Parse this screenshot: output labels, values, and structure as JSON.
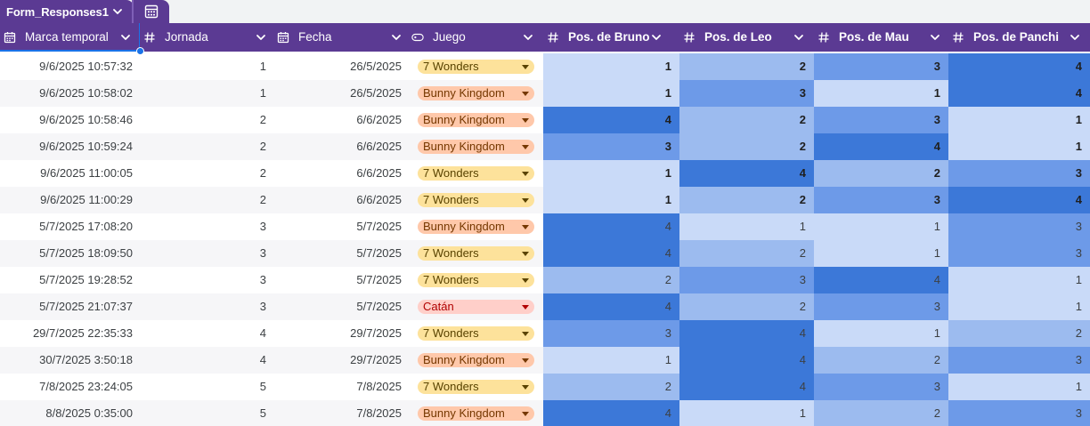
{
  "tabs": {
    "active_label": "Form_Responses1"
  },
  "colors": {
    "header_bg": "#5b3a93",
    "selection": "#1a73e8",
    "row_alt": "#f6f6f8",
    "pos_scale": {
      "1": "#c9daf8",
      "2": "#9cbbef",
      "3": "#6d9ae8",
      "4": "#3c78d8"
    },
    "chips": {
      "7 Wonders": {
        "bg": "#fde29b",
        "fg": "#594300"
      },
      "Bunny Kingdom": {
        "bg": "#ffc8aa",
        "fg": "#753800"
      },
      "Catán": {
        "bg": "#ffcfc9",
        "fg": "#b10202"
      }
    }
  },
  "columns": [
    {
      "label": "Marca temporal",
      "type_icon": "calendar-icon",
      "bold": false
    },
    {
      "label": "Jornada",
      "type_icon": "hash-icon",
      "bold": false
    },
    {
      "label": "Fecha",
      "type_icon": "calendar-icon",
      "bold": false
    },
    {
      "label": "Juego",
      "type_icon": "dropdown-chip-icon",
      "bold": false
    },
    {
      "label": "Pos. de Bruno",
      "type_icon": "hash-icon",
      "bold": true
    },
    {
      "label": "Pos. de Leo",
      "type_icon": "hash-icon",
      "bold": true
    },
    {
      "label": "Pos. de Mau",
      "type_icon": "hash-icon",
      "bold": true
    },
    {
      "label": "Pos. de Panchi",
      "type_icon": "hash-icon",
      "bold": true
    }
  ],
  "rows": [
    {
      "marca": "9/6/2025 10:57:32",
      "jornada": "1",
      "fecha": "26/5/2025",
      "juego": "7 Wonders",
      "pos": [
        "1",
        "2",
        "3",
        "4"
      ],
      "bold": true
    },
    {
      "marca": "9/6/2025 10:58:02",
      "jornada": "1",
      "fecha": "26/5/2025",
      "juego": "Bunny Kingdom",
      "pos": [
        "1",
        "3",
        "1",
        "4"
      ],
      "bold": true
    },
    {
      "marca": "9/6/2025 10:58:46",
      "jornada": "2",
      "fecha": "6/6/2025",
      "juego": "Bunny Kingdom",
      "pos": [
        "4",
        "2",
        "3",
        "1"
      ],
      "bold": true
    },
    {
      "marca": "9/6/2025 10:59:24",
      "jornada": "2",
      "fecha": "6/6/2025",
      "juego": "Bunny Kingdom",
      "pos": [
        "3",
        "2",
        "4",
        "1"
      ],
      "bold": true
    },
    {
      "marca": "9/6/2025 11:00:05",
      "jornada": "2",
      "fecha": "6/6/2025",
      "juego": "7 Wonders",
      "pos": [
        "1",
        "4",
        "2",
        "3"
      ],
      "bold": true
    },
    {
      "marca": "9/6/2025 11:00:29",
      "jornada": "2",
      "fecha": "6/6/2025",
      "juego": "7 Wonders",
      "pos": [
        "1",
        "2",
        "3",
        "4"
      ],
      "bold": true
    },
    {
      "marca": "5/7/2025 17:08:20",
      "jornada": "3",
      "fecha": "5/7/2025",
      "juego": "Bunny Kingdom",
      "pos": [
        "4",
        "1",
        "1",
        "3"
      ],
      "bold": false
    },
    {
      "marca": "5/7/2025 18:09:50",
      "jornada": "3",
      "fecha": "5/7/2025",
      "juego": "7 Wonders",
      "pos": [
        "4",
        "2",
        "1",
        "3"
      ],
      "bold": false
    },
    {
      "marca": "5/7/2025 19:28:52",
      "jornada": "3",
      "fecha": "5/7/2025",
      "juego": "7 Wonders",
      "pos": [
        "2",
        "3",
        "4",
        "1"
      ],
      "bold": false
    },
    {
      "marca": "5/7/2025 21:07:37",
      "jornada": "3",
      "fecha": "5/7/2025",
      "juego": "Catán",
      "pos": [
        "4",
        "2",
        "3",
        "1"
      ],
      "bold": false
    },
    {
      "marca": "29/7/2025 22:35:33",
      "jornada": "4",
      "fecha": "29/7/2025",
      "juego": "7 Wonders",
      "pos": [
        "3",
        "4",
        "1",
        "2"
      ],
      "bold": false
    },
    {
      "marca": "30/7/2025 3:50:18",
      "jornada": "4",
      "fecha": "29/7/2025",
      "juego": "Bunny Kingdom",
      "pos": [
        "1",
        "4",
        "2",
        "3"
      ],
      "bold": false
    },
    {
      "marca": "7/8/2025 23:24:05",
      "jornada": "5",
      "fecha": "7/8/2025",
      "juego": "7 Wonders",
      "pos": [
        "2",
        "4",
        "3",
        "1"
      ],
      "bold": false
    },
    {
      "marca": "8/8/2025 0:35:00",
      "jornada": "5",
      "fecha": "7/8/2025",
      "juego": "Bunny Kingdom",
      "pos": [
        "4",
        "1",
        "2",
        "3"
      ],
      "bold": false
    }
  ]
}
